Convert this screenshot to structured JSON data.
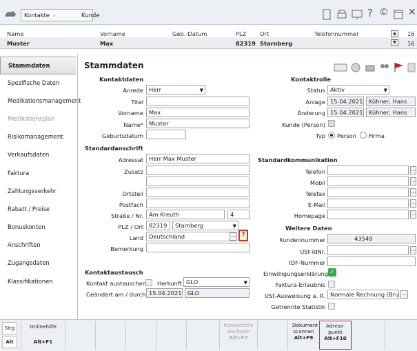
{
  "breadcrumb": {
    "root": "Kontakte",
    "current": "Kunde"
  },
  "header": {
    "cols": [
      "Name",
      "Vorname",
      "Geb.-Datum",
      "PLZ",
      "Ort",
      "Telefonnummer"
    ],
    "values": {
      "name": "Muster",
      "vorname": "Max",
      "plz": "82319",
      "ort": "Starnberg"
    },
    "count_top": "16",
    "count_bottom": "16"
  },
  "sidebar": {
    "items": [
      {
        "label": "Stammdaten"
      },
      {
        "label": "Spezifische Daten"
      },
      {
        "label": "Medikationsmanagement"
      },
      {
        "label": "Medikationsplan"
      },
      {
        "label": "Risikomanagement"
      },
      {
        "label": "Verkaufsdaten"
      },
      {
        "label": "Faktura"
      },
      {
        "label": "Zahlungsverkehr"
      },
      {
        "label": "Rabatt / Preise"
      },
      {
        "label": "Bonuskonten"
      },
      {
        "label": "Anschriften"
      },
      {
        "label": "Zugangsdaten"
      },
      {
        "label": "Klassifikationen"
      }
    ]
  },
  "main": {
    "title": "Stammdaten",
    "kontaktdaten": {
      "section": "Kontaktdaten",
      "anrede_label": "Anrede",
      "anrede": "Herr",
      "titel_label": "Titel",
      "titel": "",
      "vorname_label": "Vorname",
      "vorname": "Max",
      "name_label": "Name*",
      "name": "Muster",
      "geb_label": "Geburtsdatum",
      "geb": ""
    },
    "anschrift": {
      "section": "Standardanschrift",
      "adressat_label": "Adressat",
      "adressat": "Herr Max Muster",
      "zusatz_label": "Zusatz",
      "ortsteil_label": "Ortsteil",
      "postfach_label": "Postfach",
      "strasse_label": "Straße / Nr.",
      "strasse": "Am Kreuth",
      "nr": "4",
      "plzort_label": "PLZ / Ort",
      "plz": "82319",
      "ort": "Starnberg",
      "land_label": "Land",
      "land": "Deutschland",
      "bemerkung_label": "Bemerkung"
    },
    "austausch": {
      "section": "Kontaktaustausch",
      "kontakt_label": "Kontakt austauschen",
      "herkunft_label": "Herkunft",
      "herkunft": "GLO",
      "geaendert_label": "Geändert am / durch",
      "geaendert_date": "15.04.2021",
      "geaendert_by": "GLO"
    },
    "kontaktrolle": {
      "section": "Kontaktrolle",
      "status_label": "Status",
      "status": "Aktiv",
      "anlage_label": "Anlage",
      "anlage_date": "15.04.2021",
      "anlage_by": "Kühner, Hans",
      "aenderung_label": "Änderung",
      "aenderung_date": "15.04.2021",
      "aenderung_by": "Kühner, Hans",
      "kunde_label": "Kunde (Person)",
      "typ_label": "Typ",
      "typ_person": "Person",
      "typ_firma": "Firma"
    },
    "kommunikation": {
      "section": "Standardkommunikation",
      "telefon": "Telefon",
      "mobil": "Mobil",
      "telefax": "Telefax",
      "email": "E-Mail",
      "homepage": "Homepage"
    },
    "weitere": {
      "section": "Weitere Daten",
      "kundennummer_label": "Kundennummer",
      "kundennummer": "43549",
      "ust_label": "USt-IdNr.",
      "idf_label": "IDF-Nummer",
      "einw_label": "Einwilligungserklärung",
      "faktura_label": "Faktura-Erlaubnis",
      "ustausw_label": "USt-Ausweisung a. R.",
      "ustausw": "Normale Rechnung (Brutt",
      "getrennt_label": "Getrennte Statistik"
    }
  },
  "fkeys": {
    "strg": "Strg",
    "alt": "Alt",
    "onlinehilfe": "Onlinehilfe",
    "onlinehilfe_k": "Alt+F1",
    "kontaktrolle": "Kontaktrolle wechseln",
    "kontaktrolle_k": "Alt+F7",
    "dokument": "Dokument scannen",
    "dokument_k": "Alt+F9",
    "adresspunkt": "Adress-punkt",
    "adresspunkt_k": "Alt+F10"
  }
}
